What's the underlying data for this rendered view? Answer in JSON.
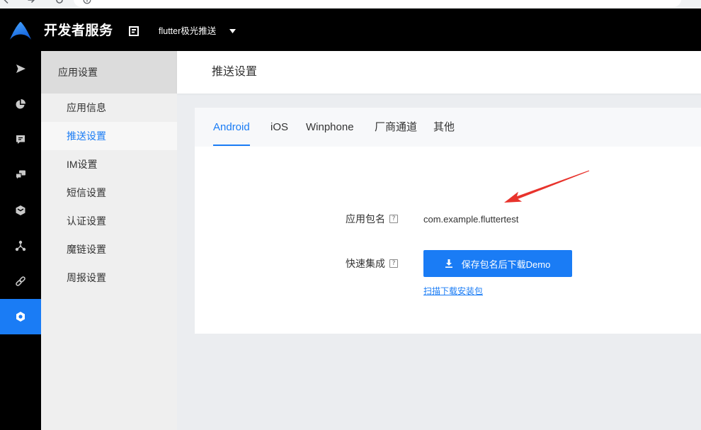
{
  "colors": {
    "accent": "#1a7cf5",
    "header_bg": "#000000",
    "annotation": "#e8332c"
  },
  "browser": {
    "icons": [
      "back-icon",
      "forward-icon",
      "reload-icon",
      "info-icon"
    ]
  },
  "header": {
    "logo_icon": "logo-icon",
    "brand": "开发者服务",
    "app_icon": "document-icon",
    "app_name": "flutter极光推送",
    "dropdown_icon": "caret-down-icon"
  },
  "icon_nav": {
    "items": [
      {
        "icon": "send-icon",
        "active": false
      },
      {
        "icon": "pie-chart-icon",
        "active": false
      },
      {
        "icon": "message-icon",
        "active": false
      },
      {
        "icon": "chat-device-icon",
        "active": false
      },
      {
        "icon": "shield-icon",
        "active": false
      },
      {
        "icon": "nodes-icon",
        "active": false
      },
      {
        "icon": "link-icon",
        "active": false
      },
      {
        "icon": "settings-icon",
        "active": true
      }
    ]
  },
  "sub_nav": {
    "title": "应用设置",
    "items": [
      {
        "label": "应用信息",
        "active": false
      },
      {
        "label": "推送设置",
        "active": true
      },
      {
        "label": "IM设置",
        "active": false
      },
      {
        "label": "短信设置",
        "active": false
      },
      {
        "label": "认证设置",
        "active": false
      },
      {
        "label": "魔链设置",
        "active": false
      },
      {
        "label": "周报设置",
        "active": false
      }
    ]
  },
  "page": {
    "title": "推送设置",
    "tabs": [
      {
        "label": "Android",
        "active": true
      },
      {
        "label": "iOS",
        "active": false
      },
      {
        "label": "Winphone",
        "active": false
      },
      {
        "label": "厂商通道",
        "active": false
      },
      {
        "label": "其他",
        "active": false
      }
    ],
    "form": {
      "package": {
        "label": "应用包名",
        "help": "?",
        "value": "com.example.fluttertest"
      },
      "integration": {
        "label": "快速集成",
        "help": "?",
        "button_icon": "download-icon",
        "button": "保存包名后下载Demo",
        "link": "扫描下载安装包"
      }
    }
  }
}
